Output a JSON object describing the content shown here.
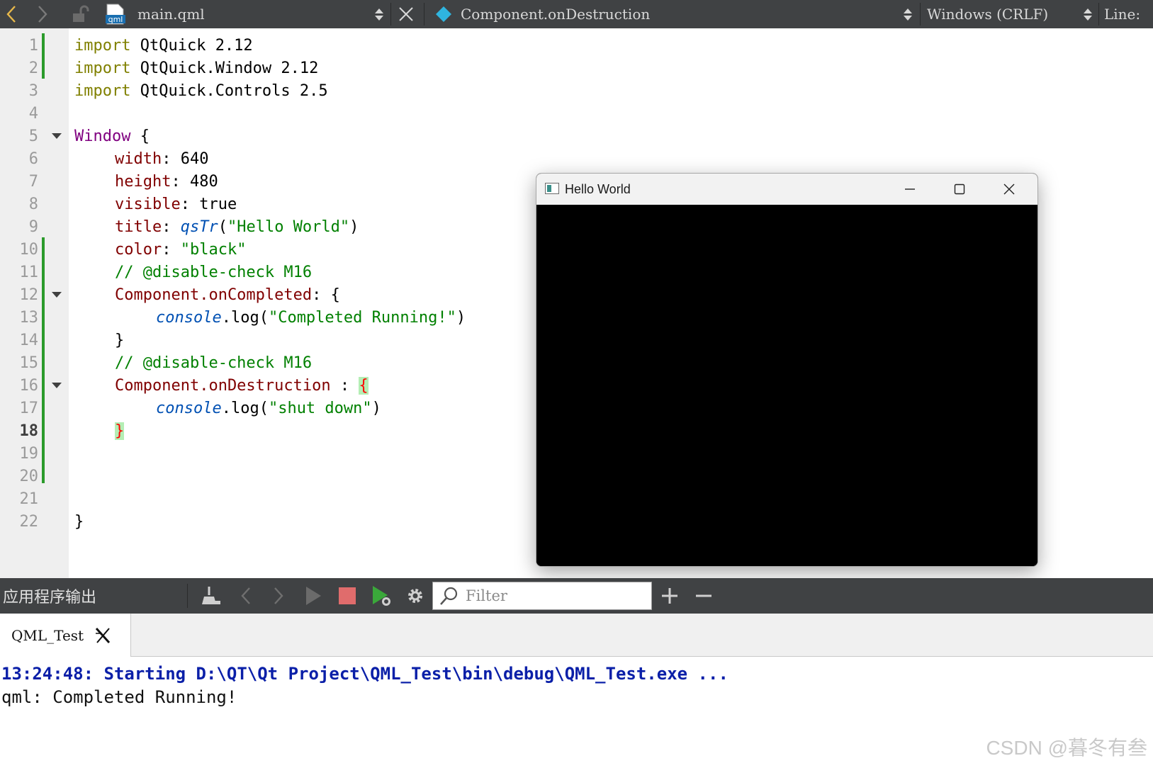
{
  "toolbar": {
    "file_name": "main.qml",
    "file_icon_label": "qml",
    "symbol": "Component.onDestruction",
    "line_endings": "Windows (CRLF)",
    "line_label": "Line:"
  },
  "editor": {
    "line_numbers": [
      "1",
      "2",
      "3",
      "4",
      "5",
      "6",
      "7",
      "8",
      "9",
      "10",
      "11",
      "12",
      "13",
      "14",
      "15",
      "16",
      "17",
      "18",
      "19",
      "20",
      "21",
      "22"
    ],
    "current_line": "18",
    "code": {
      "l1_kw": "import",
      "l1_rest": " QtQuick 2.12",
      "l2_kw": "import",
      "l2_rest": " QtQuick.Window 2.12",
      "l3_kw": "import",
      "l3_rest": " QtQuick.Controls 2.5",
      "l5_type": "Window",
      "l5_rest": " {",
      "l6_prop": "width",
      "l6_rest": ": 640",
      "l7_prop": "height",
      "l7_rest": ": 480",
      "l8_prop": "visible",
      "l8_rest": ": true",
      "l9_prop": "title",
      "l9_colon": ": ",
      "l9_fn": "qsTr",
      "l9_open": "(",
      "l9_str": "\"Hello World\"",
      "l9_close": ")",
      "l10_prop": "color",
      "l10_colon": ": ",
      "l10_str": "\"black\"",
      "l11_comment": "// @disable-check M16",
      "l12_prop": "Component.onCompleted",
      "l12_rest": ": {",
      "l13_obj": "console",
      "l13_call": ".log(",
      "l13_str": "\"Completed Running!\"",
      "l13_close": ")",
      "l14_brace": "}",
      "l15_comment": "// @disable-check M16",
      "l16_prop": "Component.onDestruction",
      "l16_colon": " : ",
      "l16_brace": "{",
      "l17_obj": "console",
      "l17_call": ".log(",
      "l17_str": "\"shut down\"",
      "l17_close": ")",
      "l18_brace": "}",
      "l21_brace": "}"
    }
  },
  "app_window": {
    "title": "Hello World",
    "background": "#000000"
  },
  "output": {
    "panel_title": "应用程序输出",
    "filter_placeholder": "Filter",
    "tab_name": "QML_Test",
    "log_lines": [
      "13:24:48: Starting D:\\QT\\Qt Project\\QML_Test\\bin\\debug\\QML_Test.exe ...",
      "qml: Completed Running!"
    ]
  },
  "watermark": "CSDN @暮冬有叁",
  "colors": {
    "keyword": "#808000",
    "type": "#800080",
    "property": "#800000",
    "string": "#008000",
    "modified_bar": "#2b9b2b",
    "log_start": "#0a1fa8",
    "stop_button": "#e06c6c"
  }
}
